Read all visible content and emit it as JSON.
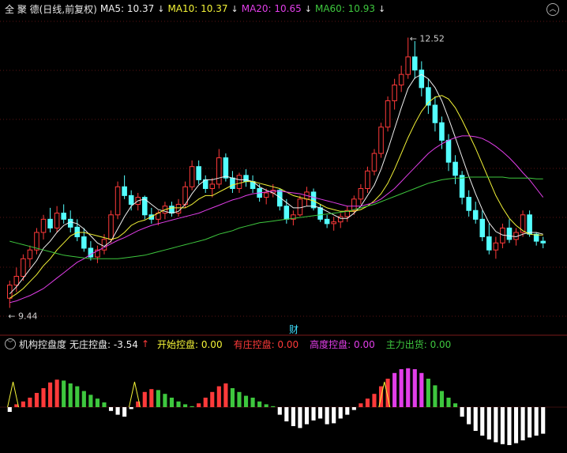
{
  "header": {
    "title": "全 聚 德(日线,前复权)",
    "ma5": "MA5: 10.37",
    "ma10": "MA10: 10.37",
    "ma20": "MA20: 10.65",
    "ma60": "MA60: 10.93",
    "settings_icon": "chevron-up-icon"
  },
  "annotations": {
    "high_label": "12.52",
    "low_label": "9.44",
    "event_marker": "财"
  },
  "indicator": {
    "name": "机构控盘度",
    "items": [
      {
        "label": "无庄控盘: -3.54",
        "color": "#f0f0f0"
      },
      {
        "label": "开始控盘: 0.00",
        "color": "#f4f437"
      },
      {
        "label": "有庄控盘: 0.00",
        "color": "#ff3a3a"
      },
      {
        "label": "高度控盘: 0.00",
        "color": "#e23ee9"
      },
      {
        "label": "主力出货: 0.00",
        "color": "#3ec73e"
      }
    ]
  },
  "colors": {
    "up": "#ff3a3a",
    "down": "#54ffff",
    "ma5": "#f0f0f0",
    "ma10": "#f4f437",
    "ma20": "#e23ee9",
    "ma60": "#3ec73e",
    "grid": "#5a1414"
  },
  "chart_data": [
    {
      "type": "candlestick",
      "title": "全 聚 德(日线,前复权)",
      "ylim": [
        9.3,
        12.75
      ],
      "ohlc": [
        [
          9.55,
          9.75,
          9.44,
          9.7
        ],
        [
          9.7,
          9.9,
          9.62,
          9.8
        ],
        [
          9.8,
          10.05,
          9.75,
          10.0
        ],
        [
          10.0,
          10.15,
          9.9,
          10.1
        ],
        [
          10.1,
          10.35,
          10.05,
          10.3
        ],
        [
          10.3,
          10.5,
          10.22,
          10.45
        ],
        [
          10.45,
          10.58,
          10.3,
          10.35
        ],
        [
          10.35,
          10.6,
          10.3,
          10.52
        ],
        [
          10.52,
          10.62,
          10.4,
          10.45
        ],
        [
          10.45,
          10.55,
          10.3,
          10.36
        ],
        [
          10.36,
          10.45,
          10.2,
          10.25
        ],
        [
          10.25,
          10.35,
          10.08,
          10.12
        ],
        [
          10.12,
          10.2,
          9.98,
          10.02
        ],
        [
          10.02,
          10.15,
          9.95,
          10.1
        ],
        [
          10.1,
          10.28,
          10.05,
          10.22
        ],
        [
          10.22,
          10.55,
          10.18,
          10.5
        ],
        [
          10.5,
          10.88,
          10.45,
          10.82
        ],
        [
          10.82,
          10.95,
          10.68,
          10.72
        ],
        [
          10.72,
          10.78,
          10.55,
          10.62
        ],
        [
          10.62,
          10.75,
          10.55,
          10.7
        ],
        [
          10.7,
          10.72,
          10.45,
          10.5
        ],
        [
          10.5,
          10.58,
          10.4,
          10.45
        ],
        [
          10.45,
          10.55,
          10.38,
          10.52
        ],
        [
          10.52,
          10.65,
          10.45,
          10.6
        ],
        [
          10.6,
          10.65,
          10.48,
          10.52
        ],
        [
          10.52,
          10.68,
          10.48,
          10.62
        ],
        [
          10.62,
          10.88,
          10.58,
          10.82
        ],
        [
          10.82,
          11.12,
          10.78,
          11.05
        ],
        [
          11.05,
          11.12,
          10.85,
          10.9
        ],
        [
          10.9,
          10.95,
          10.75,
          10.8
        ],
        [
          10.8,
          10.92,
          10.7,
          10.85
        ],
        [
          10.85,
          11.25,
          10.8,
          11.15
        ],
        [
          11.15,
          11.2,
          10.88,
          10.92
        ],
        [
          10.92,
          11.0,
          10.75,
          10.8
        ],
        [
          10.8,
          10.98,
          10.75,
          10.95
        ],
        [
          10.95,
          11.02,
          10.82,
          10.88
        ],
        [
          10.88,
          10.95,
          10.75,
          10.8
        ],
        [
          10.8,
          10.85,
          10.65,
          10.7
        ],
        [
          10.7,
          10.8,
          10.62,
          10.75
        ],
        [
          10.75,
          10.85,
          10.7,
          10.78
        ],
        [
          10.78,
          10.8,
          10.55,
          10.6
        ],
        [
          10.6,
          10.68,
          10.4,
          10.45
        ],
        [
          10.45,
          10.55,
          10.38,
          10.5
        ],
        [
          10.5,
          10.72,
          10.48,
          10.68
        ],
        [
          10.68,
          10.82,
          10.6,
          10.76
        ],
        [
          10.76,
          10.8,
          10.55,
          10.58
        ],
        [
          10.58,
          10.62,
          10.42,
          10.45
        ],
        [
          10.45,
          10.5,
          10.35,
          10.4
        ],
        [
          10.4,
          10.48,
          10.32,
          10.42
        ],
        [
          10.42,
          10.52,
          10.35,
          10.48
        ],
        [
          10.48,
          10.6,
          10.42,
          10.55
        ],
        [
          10.55,
          10.72,
          10.5,
          10.68
        ],
        [
          10.68,
          10.85,
          10.62,
          10.8
        ],
        [
          10.8,
          11.05,
          10.75,
          11.0
        ],
        [
          11.0,
          11.25,
          10.95,
          11.2
        ],
        [
          11.2,
          11.55,
          11.15,
          11.5
        ],
        [
          11.5,
          11.85,
          11.45,
          11.8
        ],
        [
          11.8,
          12.05,
          11.7,
          11.98
        ],
        [
          11.98,
          12.2,
          11.9,
          12.1
        ],
        [
          12.1,
          12.52,
          12.05,
          12.3
        ],
        [
          12.3,
          12.48,
          12.05,
          12.15
        ],
        [
          12.15,
          12.25,
          11.85,
          11.95
        ],
        [
          11.95,
          12.05,
          11.65,
          11.75
        ],
        [
          11.75,
          11.85,
          11.45,
          11.55
        ],
        [
          11.55,
          11.62,
          11.25,
          11.35
        ],
        [
          11.35,
          11.42,
          11.0,
          11.1
        ],
        [
          11.1,
          11.18,
          10.85,
          10.95
        ],
        [
          10.95,
          11.0,
          10.62,
          10.7
        ],
        [
          10.7,
          10.78,
          10.48,
          10.55
        ],
        [
          10.55,
          10.65,
          10.4,
          10.45
        ],
        [
          10.45,
          10.55,
          10.2,
          10.25
        ],
        [
          10.25,
          10.4,
          10.05,
          10.1
        ],
        [
          10.1,
          10.25,
          10.0,
          10.18
        ],
        [
          10.18,
          10.4,
          10.12,
          10.35
        ],
        [
          10.35,
          10.45,
          10.18,
          10.22
        ],
        [
          10.22,
          10.35,
          10.15,
          10.3
        ],
        [
          10.3,
          10.55,
          10.25,
          10.5
        ],
        [
          10.5,
          10.55,
          10.25,
          10.28
        ],
        [
          10.28,
          10.3,
          10.15,
          10.2
        ],
        [
          10.2,
          10.25,
          10.12,
          10.18
        ]
      ],
      "ma_series": [
        {
          "name": "MA5",
          "values": [
            9.6,
            9.68,
            9.78,
            9.88,
            9.98,
            10.12,
            10.2,
            10.3,
            10.38,
            10.42,
            10.4,
            10.34,
            10.26,
            10.18,
            10.14,
            10.2,
            10.34,
            10.48,
            10.6,
            10.66,
            10.68,
            10.62,
            10.56,
            10.54,
            10.52,
            10.54,
            10.62,
            10.74,
            10.84,
            10.9,
            10.9,
            10.92,
            10.94,
            10.92,
            10.9,
            10.9,
            10.88,
            10.82,
            10.78,
            10.75,
            10.7,
            10.64,
            10.58,
            10.58,
            10.6,
            10.6,
            10.58,
            10.54,
            10.5,
            10.46,
            10.46,
            10.52,
            10.6,
            10.72,
            10.84,
            11.02,
            11.24,
            11.48,
            11.72,
            11.94,
            12.06,
            12.1,
            12.05,
            11.95,
            11.8,
            11.6,
            11.38,
            11.16,
            10.94,
            10.74,
            10.56,
            10.41,
            10.31,
            10.27,
            10.26,
            10.25,
            10.28,
            10.3,
            10.3,
            10.28
          ]
        },
        {
          "name": "MA10",
          "values": [
            9.55,
            9.6,
            9.66,
            9.74,
            9.82,
            9.92,
            10.0,
            10.1,
            10.18,
            10.26,
            10.3,
            10.3,
            10.28,
            10.26,
            10.24,
            10.22,
            10.24,
            10.3,
            10.38,
            10.42,
            10.44,
            10.48,
            10.52,
            10.56,
            10.58,
            10.58,
            10.58,
            10.62,
            10.68,
            10.72,
            10.72,
            10.76,
            10.8,
            10.84,
            10.86,
            10.88,
            10.88,
            10.86,
            10.84,
            10.82,
            10.8,
            10.76,
            10.72,
            10.7,
            10.68,
            10.66,
            10.62,
            10.58,
            10.56,
            10.54,
            10.54,
            10.54,
            10.56,
            10.6,
            10.66,
            10.74,
            10.86,
            11.02,
            11.2,
            11.38,
            11.54,
            11.68,
            11.78,
            11.84,
            11.86,
            11.82,
            11.72,
            11.58,
            11.42,
            11.26,
            11.08,
            10.9,
            10.72,
            10.58,
            10.46,
            10.38,
            10.32,
            10.28,
            10.27,
            10.27
          ]
        },
        {
          "name": "MA20",
          "values": [
            9.5,
            9.52,
            9.55,
            9.58,
            9.62,
            9.66,
            9.72,
            9.78,
            9.84,
            9.9,
            9.96,
            10.0,
            10.05,
            10.09,
            10.13,
            10.17,
            10.21,
            10.24,
            10.28,
            10.32,
            10.35,
            10.38,
            10.4,
            10.42,
            10.44,
            10.46,
            10.48,
            10.5,
            10.52,
            10.55,
            10.58,
            10.61,
            10.64,
            10.67,
            10.69,
            10.72,
            10.74,
            10.75,
            10.76,
            10.77,
            10.77,
            10.76,
            10.75,
            10.74,
            10.72,
            10.7,
            10.68,
            10.66,
            10.64,
            10.62,
            10.6,
            10.6,
            10.6,
            10.62,
            10.64,
            10.68,
            10.74,
            10.8,
            10.88,
            10.96,
            11.04,
            11.12,
            11.2,
            11.26,
            11.31,
            11.35,
            11.38,
            11.4,
            11.4,
            11.39,
            11.37,
            11.33,
            11.28,
            11.22,
            11.15,
            11.07,
            10.98,
            10.9,
            10.8,
            10.7
          ]
        },
        {
          "name": "MA60",
          "values": [
            10.2,
            10.18,
            10.16,
            10.14,
            10.12,
            10.1,
            10.08,
            10.06,
            10.04,
            10.03,
            10.02,
            10.01,
            10.0,
            10.0,
            10.0,
            10.0,
            10.0,
            10.01,
            10.02,
            10.03,
            10.04,
            10.06,
            10.08,
            10.1,
            10.12,
            10.14,
            10.16,
            10.18,
            10.2,
            10.22,
            10.25,
            10.28,
            10.3,
            10.32,
            10.35,
            10.37,
            10.39,
            10.41,
            10.42,
            10.43,
            10.44,
            10.45,
            10.46,
            10.47,
            10.48,
            10.49,
            10.5,
            10.51,
            10.52,
            10.53,
            10.54,
            10.56,
            10.58,
            10.6,
            10.62,
            10.65,
            10.68,
            10.71,
            10.74,
            10.77,
            10.8,
            10.83,
            10.86,
            10.88,
            10.9,
            10.91,
            10.92,
            10.92,
            10.93,
            10.93,
            10.93,
            10.93,
            10.93,
            10.93,
            10.92,
            10.92,
            10.92,
            10.92,
            10.91,
            10.91
          ]
        }
      ]
    },
    {
      "type": "bar",
      "title": "机构控盘度",
      "values": [
        -0.5,
        0.3,
        0.6,
        1.0,
        1.5,
        2.0,
        2.6,
        2.9,
        2.8,
        2.5,
        2.2,
        1.7,
        1.3,
        0.9,
        0.5,
        -0.4,
        -0.8,
        -1.0,
        -0.2,
        0.6,
        1.6,
        1.9,
        1.8,
        1.4,
        1.0,
        0.6,
        0.3,
        0.1,
        0.4,
        1.0,
        1.6,
        2.2,
        2.5,
        2.0,
        1.6,
        1.2,
        1.0,
        0.6,
        0.3,
        0.1,
        -0.8,
        -1.5,
        -2.0,
        -2.2,
        -1.8,
        -1.4,
        -1.2,
        -1.8,
        -1.7,
        -1.2,
        -0.8,
        -0.3,
        0.4,
        0.9,
        1.4,
        2.2,
        3.0,
        3.6,
        4.0,
        4.1,
        4.0,
        3.6,
        3.0,
        2.3,
        1.7,
        1.0,
        0.4,
        -1.0,
        -1.8,
        -2.5,
        -3.0,
        -3.4,
        -3.7,
        -3.9,
        -4.0,
        -3.8,
        -3.5,
        -3.2,
        -3.0,
        -2.8
      ]
    }
  ]
}
